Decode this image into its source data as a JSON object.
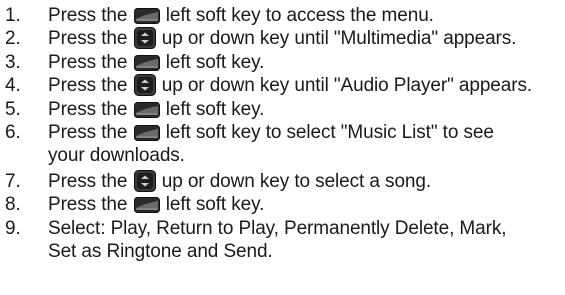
{
  "steps": [
    {
      "num": "1.",
      "before": "Press the",
      "icon": "left-soft-key-icon",
      "after": " left soft key to access the menu."
    },
    {
      "num": "2.",
      "before": "Press the",
      "icon": "up-down-key-icon",
      "after": " up or down key until \"Multimedia\" appears."
    },
    {
      "num": "3.",
      "before": "Press the",
      "icon": "left-soft-key-icon",
      "after": " left soft key."
    },
    {
      "num": "4.",
      "before": "Press the",
      "icon": "up-down-key-icon",
      "after": " up or down key until \"Audio Player\" appears."
    },
    {
      "num": "5.",
      "before": "Press the",
      "icon": "left-soft-key-icon",
      "after": " left soft key."
    },
    {
      "num": "6.",
      "before": "Press the",
      "icon": "left-soft-key-icon",
      "after": " left soft key to select \"Music List\" to see",
      "line2": "your downloads."
    },
    {
      "num": "7.",
      "before": "Press the",
      "icon": "up-down-key-icon",
      "after": " up or down key to select a song."
    },
    {
      "num": "8.",
      "before": "Press the",
      "icon": "left-soft-key-icon",
      "after": " left soft key."
    },
    {
      "num": "9.",
      "text": "Select: Play, Return to Play, Permanently Delete, Mark,",
      "line2": "Set as Ringtone and Send."
    }
  ]
}
